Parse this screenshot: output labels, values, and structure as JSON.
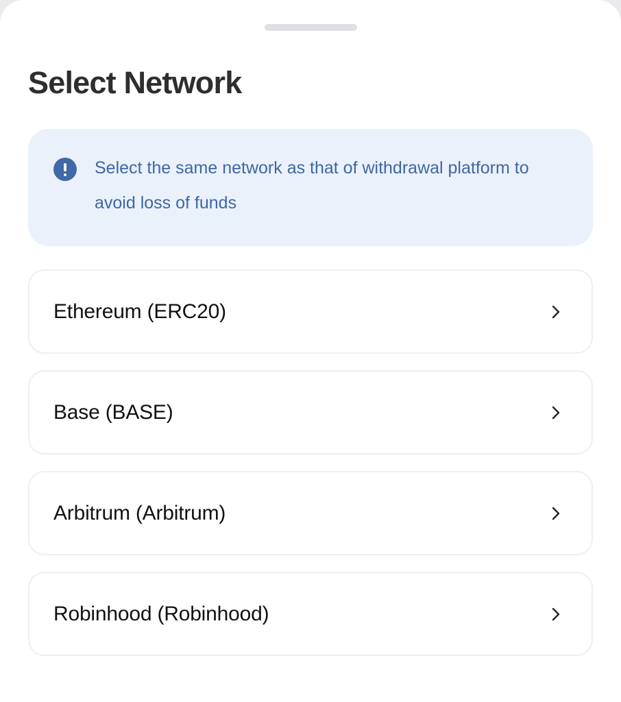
{
  "sheet": {
    "title": "Select Network"
  },
  "notice": {
    "icon": "info-exclamation-icon",
    "text": "Select the same network as that of withdrawal platform to avoid loss of funds",
    "color": "#3f67a3",
    "background": "#eaf1fb"
  },
  "networks": [
    {
      "label": "Ethereum (ERC20)"
    },
    {
      "label": "Base (BASE)"
    },
    {
      "label": "Arbitrum (Arbitrum)"
    },
    {
      "label": "Robinhood (Robinhood)"
    }
  ]
}
